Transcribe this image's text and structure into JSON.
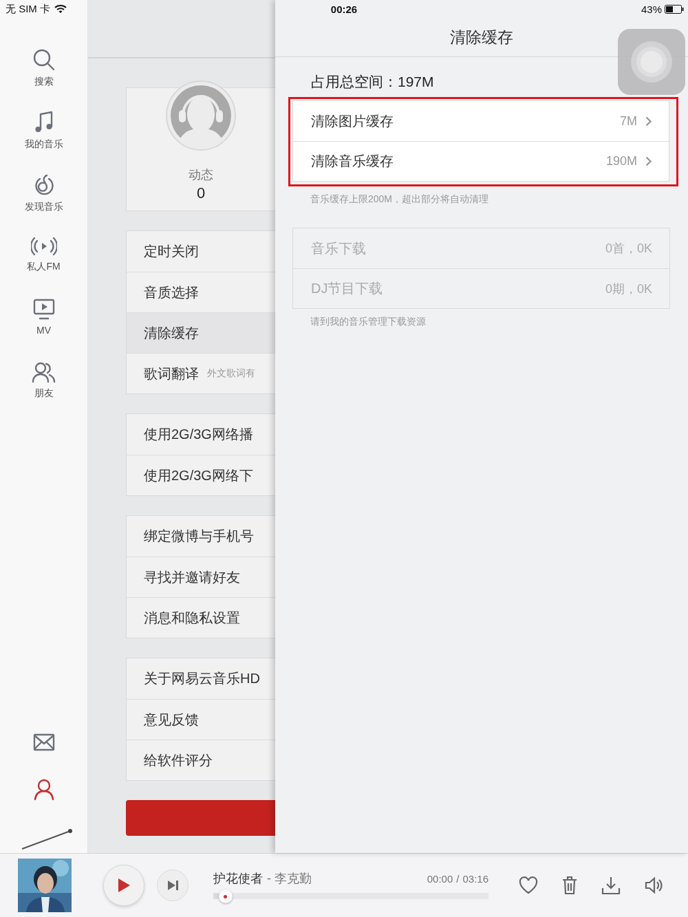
{
  "status_bar": {
    "carrier": "无 SIM 卡",
    "time": "00:26",
    "battery": "43%"
  },
  "sidebar": {
    "items": [
      {
        "label": "搜索",
        "selected": false
      },
      {
        "label": "我的音乐",
        "selected": false
      },
      {
        "label": "发现音乐",
        "selected": false
      },
      {
        "label": "私人FM",
        "selected": false
      },
      {
        "label": "MV",
        "selected": false
      },
      {
        "label": "朋友",
        "selected": false
      }
    ],
    "bottom_items": [
      {
        "selected": false
      },
      {
        "selected": true
      }
    ]
  },
  "profile": {
    "stat_label": "动态",
    "stat_value": "0"
  },
  "settings_groups": [
    [
      {
        "label": "定时关闭",
        "selected": false
      },
      {
        "label": "音质选择",
        "selected": false
      },
      {
        "label": "清除缓存",
        "selected": true
      },
      {
        "label": "歌词翻译",
        "hint": "外文歌词有",
        "selected": false
      }
    ],
    [
      {
        "label": "使用2G/3G网络播",
        "selected": false
      },
      {
        "label": "使用2G/3G网络下",
        "selected": false
      }
    ],
    [
      {
        "label": "绑定微博与手机号",
        "selected": false
      },
      {
        "label": "寻找并邀请好友",
        "selected": false
      },
      {
        "label": "消息和隐私设置",
        "selected": false
      }
    ],
    [
      {
        "label": "关于网易云音乐HD",
        "selected": false
      },
      {
        "label": "意见反馈",
        "selected": false
      },
      {
        "label": "给软件评分",
        "selected": false
      }
    ]
  ],
  "detail": {
    "title": "清除缓存",
    "total": "占用总空间：197M",
    "highlighted": true,
    "cache_items": [
      {
        "label": "清除图片缓存",
        "value": "7M"
      },
      {
        "label": "清除音乐缓存",
        "value": "190M"
      }
    ],
    "cache_note": "音乐缓存上限200M，超出部分将自动清理",
    "download_items": [
      {
        "label": "音乐下载",
        "value": "0首，0K",
        "disabled": true
      },
      {
        "label": "DJ节目下载",
        "value": "0期，0K",
        "disabled": true
      }
    ],
    "download_note": "请到我的音乐管理下载资源"
  },
  "player": {
    "title": "护花使者",
    "artist": "- 李克勤",
    "elapsed": "00:00",
    "separator": "/",
    "duration": "03:16",
    "level": 0.02
  }
}
